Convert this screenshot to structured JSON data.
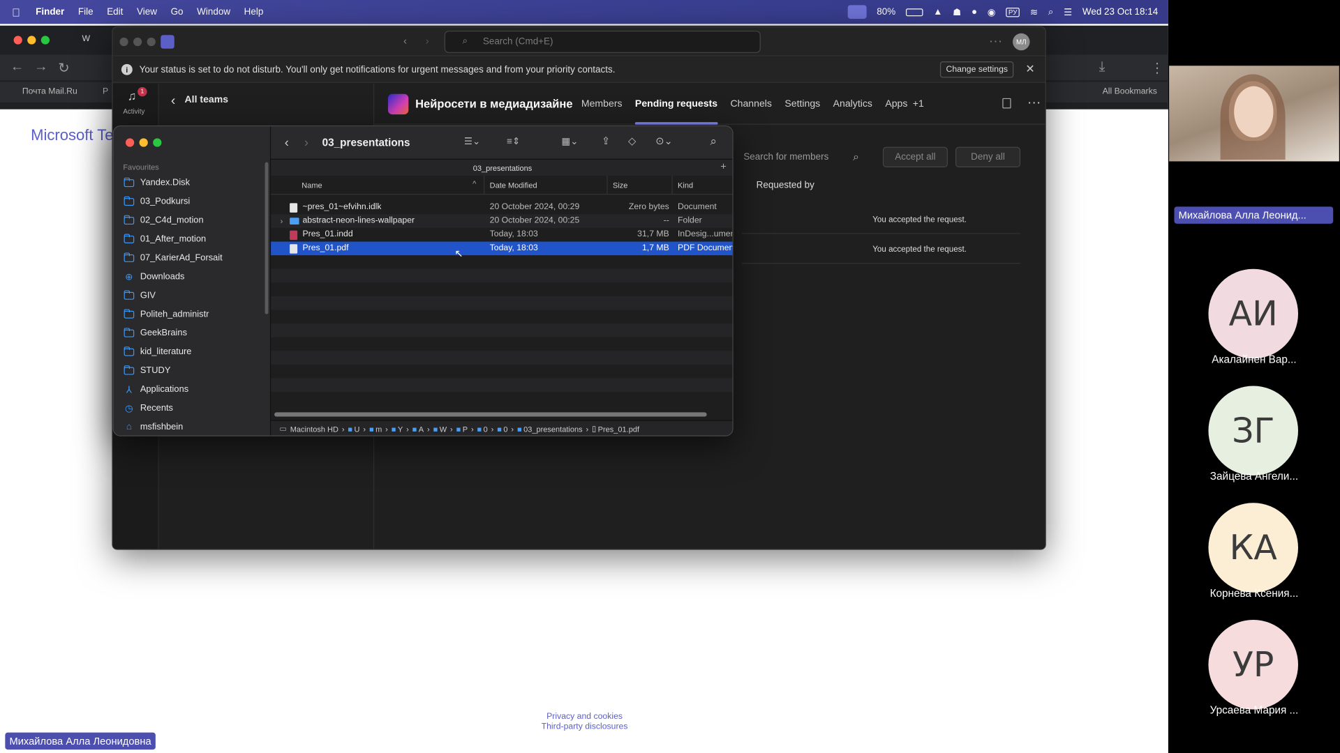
{
  "menubar": {
    "app": "Finder",
    "items": [
      "File",
      "Edit",
      "View",
      "Go",
      "Window",
      "Help"
    ],
    "battery": "80%",
    "clock": "Wed 23 Oct 18:14"
  },
  "browser": {
    "tab_label": "W",
    "bookmark_1": "Почта Mail.Ru",
    "bookmark_2": "Р",
    "all_bookmarks": "All Bookmarks",
    "page_title": "Microsoft Te",
    "footer_privacy": "Privacy and cookies",
    "footer_third_party": "Third-party disclosures"
  },
  "teams": {
    "search_placeholder": "Search (Cmd+E)",
    "avatar_initials": "МЛ",
    "notice": "Your status is set to do not disturb. You'll only get notifications for urgent messages and from your priority contacts.",
    "change_settings": "Change settings",
    "activity_label": "Activity",
    "activity_badge": "1",
    "all_teams": "All teams",
    "team_name": "Нейросети в медиадизайне",
    "tabs": [
      "Members",
      "Pending requests",
      "Channels",
      "Settings",
      "Analytics",
      "Apps",
      "+1"
    ],
    "active_tab": "Pending requests",
    "search_members": "Search for members",
    "accept_all": "Accept all",
    "deny_all": "Deny all",
    "requested_by": "Requested by",
    "accepted_1": "You accepted the request.",
    "accepted_2": "You accepted the request."
  },
  "finder": {
    "title": "03_presentations",
    "path_title": "03_presentations",
    "favourites_label": "Favourites",
    "sidebar": [
      "Yandex.Disk",
      "03_Podkursi",
      "02_C4d_motion",
      "01_After_motion",
      "07_KarierAd_Forsait",
      "Downloads",
      "GIV",
      "Politeh_administr",
      "GeekBrains",
      "kid_literature",
      "STUDY",
      "Applications",
      "Recents",
      "msfishbein"
    ],
    "columns": {
      "name": "Name",
      "date": "Date Modified",
      "size": "Size",
      "kind": "Kind"
    },
    "rows": [
      {
        "name": "~pres_01~efvihn.idlk",
        "date": "20 October 2024, 00:29",
        "size": "Zero bytes",
        "kind": "Document",
        "type": "file"
      },
      {
        "name": "abstract-neon-lines-wallpaper",
        "date": "20 October 2024, 00:25",
        "size": "--",
        "kind": "Folder",
        "type": "folder"
      },
      {
        "name": "Pres_01.indd",
        "date": "Today, 18:03",
        "size": "31,7 MB",
        "kind": "InDesig...ument",
        "type": "indd"
      },
      {
        "name": "Pres_01.pdf",
        "date": "Today, 18:03",
        "size": "1,7 MB",
        "kind": "PDF Document",
        "type": "pdf",
        "selected": true
      }
    ],
    "pathbar": [
      "Macintosh HD",
      "U",
      "m",
      "Y",
      "A",
      "W",
      "P",
      "0",
      "0",
      "03_presentations",
      "Pres_01.pdf"
    ]
  },
  "participants": {
    "speaker": "Михайлова Алла Леонид...",
    "list": [
      {
        "initials": "АИ",
        "name": "Акалайнен Вар..."
      },
      {
        "initials": "ЗГ",
        "name": "Зайцева Ангели..."
      },
      {
        "initials": "КА",
        "name": "Корнева Ксения..."
      },
      {
        "initials": "УР",
        "name": "Урсаева Мария ..."
      }
    ],
    "self_name": "Михайлова Алла Леонидовна"
  }
}
